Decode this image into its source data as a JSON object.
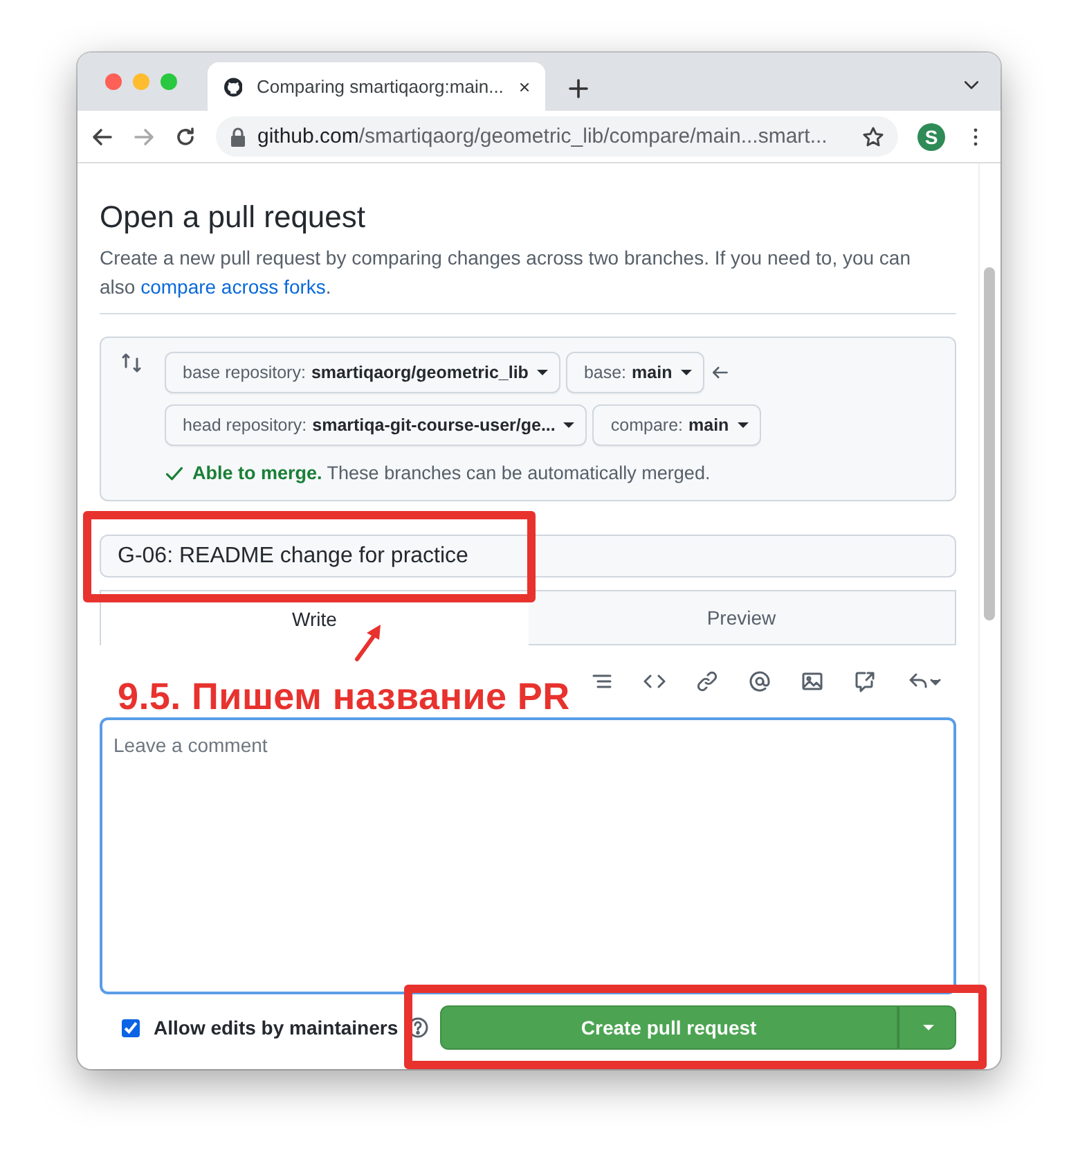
{
  "browser": {
    "tab_title": "Comparing smartiqaorg:main...",
    "url_host": "github.com",
    "url_path": "/smartiqaorg/geometric_lib/compare/main...smart...",
    "profile_initial": "S"
  },
  "page": {
    "title": "Open a pull request",
    "description_before": "Create a new pull request by comparing changes across two branches. If you need to, you can also ",
    "description_link": "compare across forks",
    "description_after": "."
  },
  "compare": {
    "rows": [
      [
        {
          "label": "base repository:",
          "value": "smartiqaorg/geometric_lib"
        },
        {
          "label": "base:",
          "value": "main"
        }
      ],
      [
        {
          "label": "head repository:",
          "value": "smartiqa-git-course-user/ge..."
        },
        {
          "label": "compare:",
          "value": "main"
        }
      ]
    ],
    "status_strong": "Able to merge.",
    "status_text": "These branches can be automatically merged."
  },
  "title_field": {
    "value": "G-06: README change for practice"
  },
  "tabs": [
    {
      "label": "Write",
      "selected": true
    },
    {
      "label": "Preview",
      "selected": false
    }
  ],
  "comment": {
    "placeholder": "Leave a comment"
  },
  "allow_edits": {
    "label": "Allow edits by maintainers",
    "checked": true
  },
  "submit": {
    "label": "Create pull request"
  },
  "annotation": {
    "caption": "9.5. Пишем название PR"
  }
}
